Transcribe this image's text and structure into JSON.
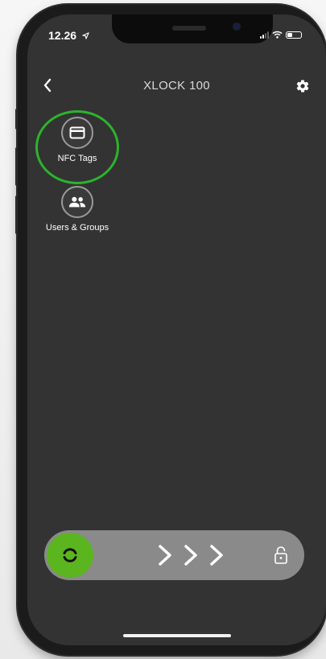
{
  "status_bar": {
    "time": "12.26",
    "icons": [
      "location-arrow-icon",
      "cellular-signal-icon",
      "wifi-icon",
      "battery-icon"
    ],
    "battery_level": 0.35
  },
  "header": {
    "title": "XLOCK 100",
    "back_icon": "chevron-left-icon",
    "settings_icon": "gear-icon"
  },
  "features": [
    {
      "label": "NFC Tags",
      "icon": "card-icon",
      "highlighted": true
    },
    {
      "label": "Users & Groups",
      "icon": "users-icon",
      "highlighted": false
    }
  ],
  "slider": {
    "knob_icon": "brand-logo-icon",
    "arrow_icon": "chevron-right-icon",
    "lock_icon": "unlocked-padlock-icon"
  },
  "colors": {
    "screen_background": "#333333",
    "accent_green": "#5bb51f",
    "highlight_ring": "#2bb42b",
    "slider_track": "#8a8a8a"
  }
}
